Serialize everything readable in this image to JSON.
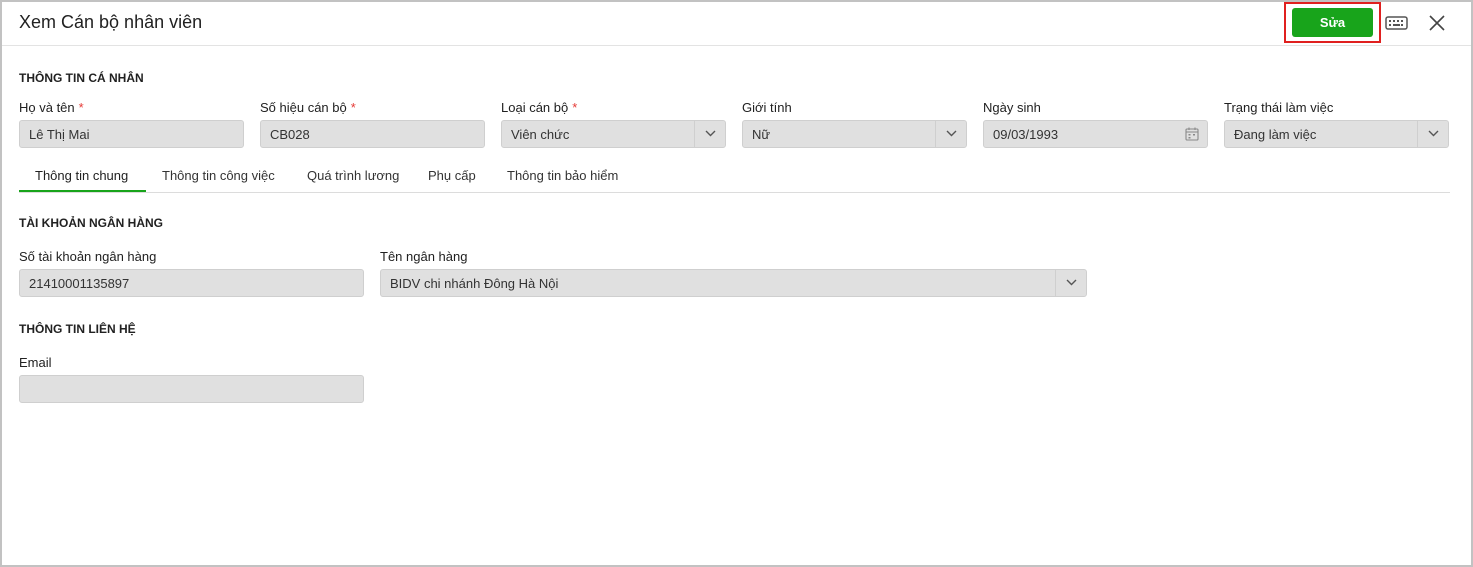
{
  "header": {
    "title": "Xem Cán bộ nhân viên",
    "edit_label": "Sửa",
    "keyboard_icon": "keyboard-icon",
    "close_icon": "close-icon"
  },
  "personal": {
    "section_title": "THÔNG TIN CÁ NHÂN",
    "full_name": {
      "label": "Họ và tên",
      "required": "*",
      "value": "Lê Thị Mai"
    },
    "staff_code": {
      "label": "Số hiệu cán bộ",
      "required": "*",
      "value": "CB028"
    },
    "staff_type": {
      "label": "Loại cán bộ",
      "required": "*",
      "value": "Viên chức"
    },
    "gender": {
      "label": "Giới tính",
      "value": "Nữ"
    },
    "birthday": {
      "label": "Ngày sinh",
      "value": "09/03/1993"
    },
    "work_status": {
      "label": "Trạng thái làm việc",
      "value": "Đang làm việc"
    }
  },
  "tabs": [
    {
      "label": "Thông tin chung",
      "active": true
    },
    {
      "label": "Thông tin công việc"
    },
    {
      "label": "Quá trình lương"
    },
    {
      "label": "Phụ cấp"
    },
    {
      "label": "Thông tin bảo hiểm"
    }
  ],
  "bank": {
    "section_title": "TÀI KHOẢN NGÂN HÀNG",
    "account": {
      "label": "Số tài khoản ngân hàng",
      "value": "21410001135897"
    },
    "bank_name": {
      "label": "Tên ngân hàng",
      "value": "BIDV chi nhánh Đông Hà Nội"
    }
  },
  "contact": {
    "section_title": "THÔNG TIN LIÊN HỆ",
    "email": {
      "label": "Email",
      "value": ""
    }
  },
  "colors": {
    "accent": "#18a41b",
    "highlight": "#e0201f",
    "required": "#e53935",
    "field_bg": "#e0e0e0"
  }
}
